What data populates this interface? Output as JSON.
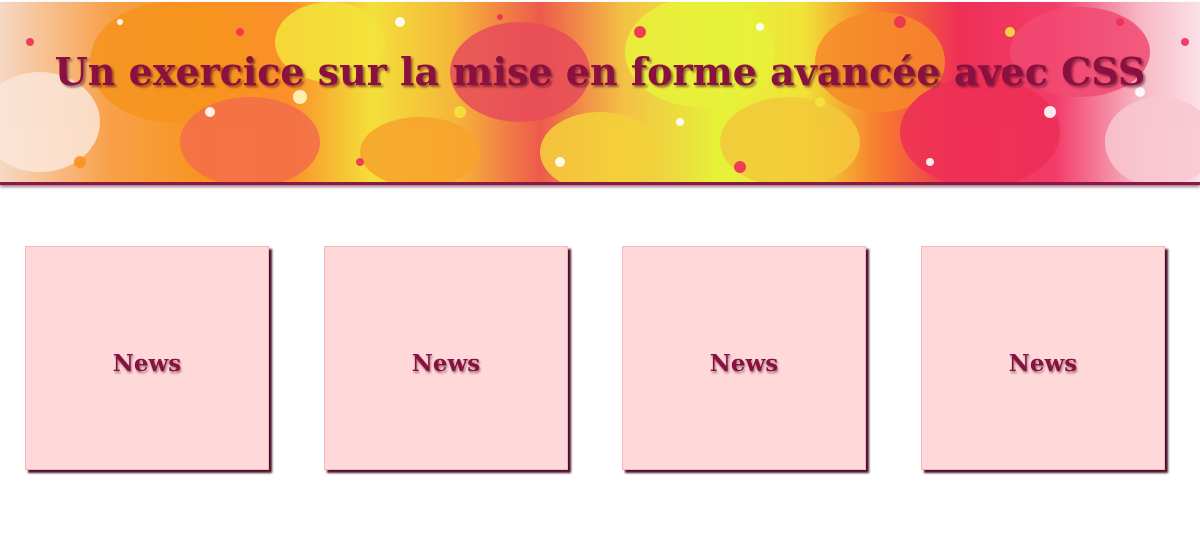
{
  "header": {
    "title": "Un exercice sur la mise en forme avancée avec CSS"
  },
  "news_cards": [
    {
      "label": "News"
    },
    {
      "label": "News"
    },
    {
      "label": "News"
    },
    {
      "label": "News"
    }
  ],
  "colors": {
    "title_text": "#8a1040",
    "banner_border": "#8a1845",
    "card_background": "#ffd9da",
    "card_shadow": "#4a1028",
    "page_background": "#ffffff"
  }
}
